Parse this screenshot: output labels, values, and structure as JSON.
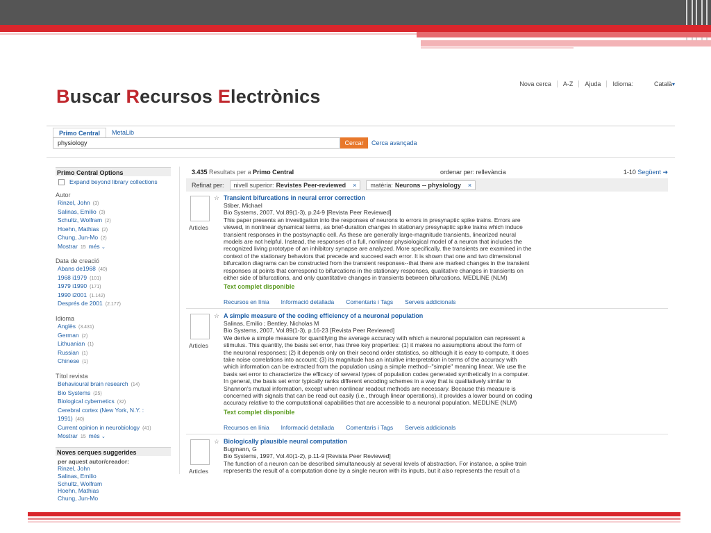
{
  "header": {
    "title_parts": [
      {
        "cap": "B",
        "rest": "uscar "
      },
      {
        "cap": "R",
        "rest": "ecursos "
      },
      {
        "cap": "E",
        "rest": "lectrònics"
      }
    ],
    "nav": {
      "new_search": "Nova cerca",
      "az": "A-Z",
      "help": "Ajuda",
      "language_label": "Idioma:",
      "language_value": "Català"
    }
  },
  "search": {
    "tabs": [
      "Primo Central",
      "MetaLib"
    ],
    "query": "physiology",
    "button": "Cercar",
    "advanced": "Cerca avançada"
  },
  "sidebar": {
    "options_title": "Primo Central Options",
    "expand_label": "Expand beyond library collections",
    "facets": [
      {
        "title": "Autor",
        "items": [
          {
            "label": "Rinzel, John",
            "count": "(3)"
          },
          {
            "label": "Salinas, Emilio",
            "count": "(3)"
          },
          {
            "label": "Schultz, Wolfram",
            "count": "(2)"
          },
          {
            "label": "Hoehn, Mathias",
            "count": "(2)"
          },
          {
            "label": "Chung, Jun-Mo",
            "count": "(2)"
          }
        ],
        "more": {
          "label": "Mostrar",
          "num": "15",
          "mes": "més"
        }
      },
      {
        "title": "Data de creació",
        "items": [
          {
            "label": "Abans de1968",
            "count": "(40)"
          },
          {
            "label": "1968 i1979",
            "count": "(101)"
          },
          {
            "label": "1979 i1990",
            "count": "(171)"
          },
          {
            "label": "1990 i2001",
            "count": "(1.142)"
          },
          {
            "label": "Després de 2001",
            "count": "(2.177)"
          }
        ]
      },
      {
        "title": "Idioma",
        "items": [
          {
            "label": "Anglès",
            "count": "(3.431)"
          },
          {
            "label": "German",
            "count": "(2)"
          },
          {
            "label": "Lithuanian",
            "count": "(1)"
          },
          {
            "label": "Russian",
            "count": "(1)"
          },
          {
            "label": "Chinese",
            "count": "(1)"
          }
        ]
      },
      {
        "title": "Títol revista",
        "items": [
          {
            "label": "Behavioural brain research",
            "count": "(14)"
          },
          {
            "label": "Bio Systems",
            "count": "(25)"
          },
          {
            "label": "Biological cybernetics",
            "count": "(32)"
          },
          {
            "label": "Cerebral cortex (New York, N.Y. :",
            "count": ""
          },
          {
            "label": "1991)",
            "count": "(40)"
          },
          {
            "label": "Current opinion in neurobiology",
            "count": "(41)"
          }
        ],
        "more": {
          "label": "Mostrar",
          "num": "15",
          "mes": "més"
        }
      }
    ],
    "suggest_title": "Noves cerques suggerides",
    "suggest_subtitle": "per aquest autor/creador:",
    "suggest_items": [
      "Rinzel, John",
      "Salinas, Emilio",
      "Schultz, Wolfram",
      "Hoehn, Mathias",
      "Chung, Jun-Mo"
    ]
  },
  "results": {
    "count": "3.435",
    "count_text": "Resultats per a",
    "scope": "Primo Central",
    "order_label": "ordenar per:",
    "order_value": "rellevància",
    "range": "1-10",
    "next": "Següent ➜",
    "refine_label": "Refinat per:",
    "chips": [
      {
        "key": "nivell superior:",
        "value": "Revistes Peer-reviewed",
        "close": "×"
      },
      {
        "key": "matèria:",
        "value": "Neurons -- physiology",
        "close": "×"
      }
    ],
    "records": [
      {
        "type": "Articles",
        "title": "Transient bifurcations in neural error correction",
        "author": "Stiber, Michael",
        "source": "Bio Systems, 2007, Vol.89(1-3), p.24-9 [Revista Peer Reviewed]",
        "abstract": [
          "This paper presents an investigation into the responses of neurons to errors in presynaptic spike trains. Errors are",
          "viewed, in nonlinear dynamical terms, as brief-duration changes in stationary presynaptic spike trains which induce",
          "transient responses in the postsynaptic cell. As these are generally large-magnitude transients, linearized neural",
          "models are not helpful. Instead, the responses of a full, nonlinear physiological model of a neuron that includes the",
          "recognized living prototype of an inhibitory synapse are analyzed. More specifically, the transients are examined in the",
          "context of the stationary behaviors that precede and succeed each error. It is shown that one and two dimensional",
          "bifurcation diagrams can be constructed from the transient responses--that there are marked changes in the transient",
          "responses at points that correspond to bifurcations in the stationary responses, qualitative changes in transients on",
          "either side of bifurcations, and only quantitative changes in transients between bifurcations. MEDLINE (NLM)"
        ],
        "availability": "Text complet disponible",
        "links": [
          "Recursos en línia",
          "Informació detallada",
          "Comentaris i Tags",
          "Serveis addicionals"
        ]
      },
      {
        "type": "Articles",
        "title": "A simple measure of the coding efficiency of a neuronal population",
        "author": "Salinas, Emilio ; Bentley, Nicholas M",
        "source": "Bio Systems, 2007, Vol.89(1-3), p.16-23 [Revista Peer Reviewed]",
        "abstract": [
          "We derive a simple measure for quantifying the average accuracy with which a neuronal population can represent a",
          "stimulus. This quantity, the basis set error, has three key properties: (1) it makes no assumptions about the form of",
          "the neuronal responses; (2) it depends only on their second order statistics, so although it is easy to compute, it does",
          "take noise correlations into account; (3) its magnitude has an intuitive interpretation in terms of the accuracy with",
          "which information can be extracted from the population using a simple method--\"simple\" meaning linear. We use the",
          "basis set error to characterize the efficacy of several types of population codes generated synthetically in a computer.",
          "In general, the basis set error typically ranks different encoding schemes in a way that is qualitatively similar to",
          "Shannon's mutual information, except when nonlinear readout methods are necessary. Because this measure is",
          "concerned with signals that can be read out easily (i.e., through linear operations), it provides a lower bound on coding",
          "accuracy relative to the computational capabilities that are accessible to a neuronal population. MEDLINE (NLM)"
        ],
        "availability": "Text complet disponible",
        "links": [
          "Recursos en línia",
          "Informació detallada",
          "Comentaris i Tags",
          "Serveis addicionals"
        ]
      },
      {
        "type": "Articles",
        "title": "Biologically plausible neural computation",
        "author": "Bugmann, G",
        "source": "Bio Systems, 1997, Vol.40(1-2), p.11-9 [Revista Peer Reviewed]",
        "abstract": [
          "The function of a neuron can be described simultaneously at several levels of abstraction. For instance, a spike train",
          "represents the result of a computation done by a single neuron with its inputs, but it also represents the result of a"
        ]
      }
    ]
  }
}
